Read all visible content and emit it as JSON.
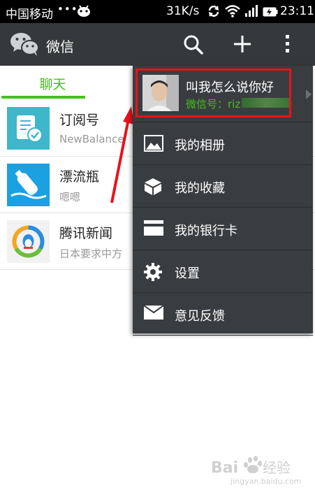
{
  "status_bar": {
    "carrier": "中国移动",
    "dots": "•••",
    "speed": "31K/s",
    "time": "23:11"
  },
  "app_bar": {
    "title": "微信"
  },
  "tabs": {
    "chat_label": "聊天",
    "accent": "#45c01a"
  },
  "chats": [
    {
      "name": "订阅号",
      "snippet": "NewBalance",
      "icon": "subscription-icon",
      "color": "#3db7c9"
    },
    {
      "name": "漂流瓶",
      "snippet": "嗯嗯",
      "icon": "bottle-icon",
      "color": "#1ba0e2"
    },
    {
      "name": "腾讯新闻",
      "snippet": "日本要求中方",
      "icon": "tencent-news-icon",
      "color": "#f0f0f0"
    }
  ],
  "menu": {
    "profile": {
      "nickname": "叫我怎么说你好",
      "wechat_id": "微信号：riz"
    },
    "items": [
      {
        "label": "我的相册",
        "icon": "album-icon"
      },
      {
        "label": "我的收藏",
        "icon": "favorites-icon"
      },
      {
        "label": "我的银行卡",
        "icon": "bank-card-icon"
      },
      {
        "label": "设置",
        "icon": "settings-icon"
      },
      {
        "label": "意见反馈",
        "icon": "feedback-icon"
      }
    ],
    "background": "#3a3d40",
    "highlight_color": "#e8121b"
  },
  "watermark": {
    "brand": "Bai",
    "suffix": "经验",
    "url": "jingyan.baidu.com"
  }
}
